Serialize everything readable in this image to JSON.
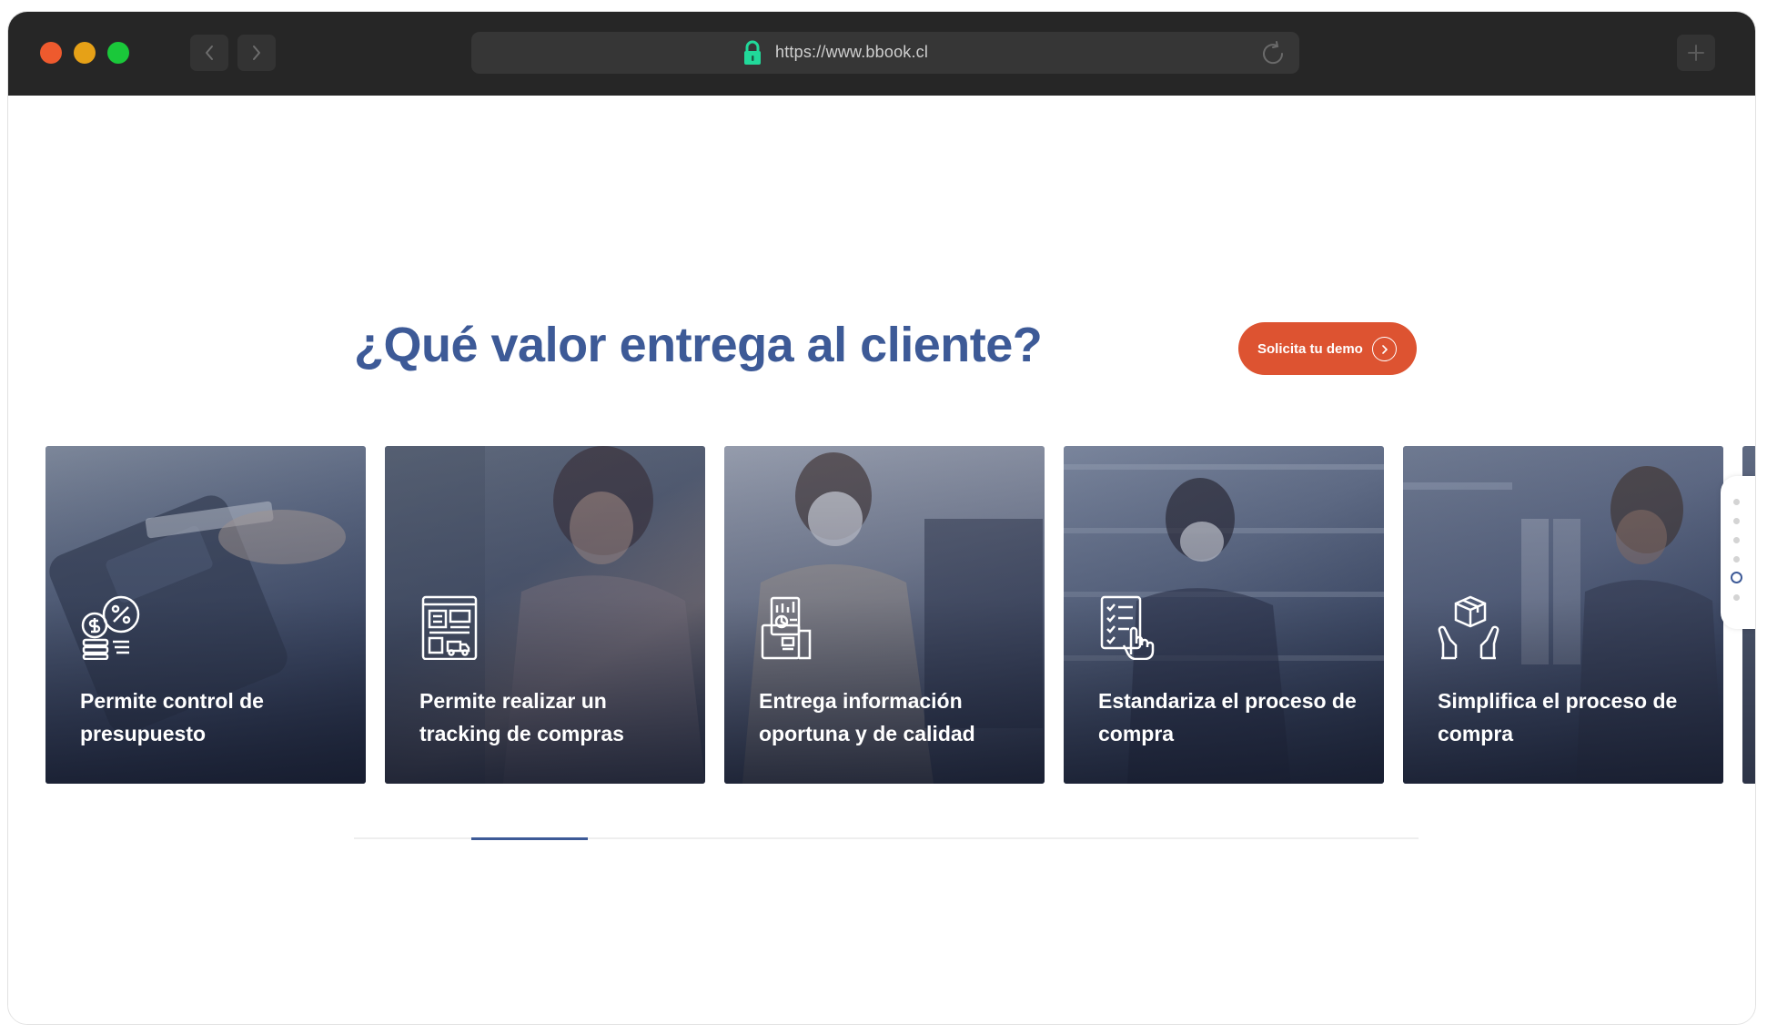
{
  "browser": {
    "url": "https://www.bbook.cl",
    "icons": {
      "back": "chevron-left-icon",
      "forward": "chevron-right-icon",
      "lock": "lock-icon",
      "reload": "reload-icon",
      "new_tab": "plus-icon"
    }
  },
  "section": {
    "title": "¿Qué valor entrega al cliente?",
    "cta_label": "Solicita tu demo",
    "cta_icon": "chevron-right-circle-icon",
    "accent_color": "#3d5a97",
    "cta_color": "#dd5331"
  },
  "cards": [
    {
      "label": "Permite control de presupuesto",
      "icon": "budget-coins-icon"
    },
    {
      "label": "Permite realizar un tracking de compras",
      "icon": "tracking-dashboard-icon"
    },
    {
      "label": "Entrega información oportuna y de calidad",
      "icon": "report-documents-icon"
    },
    {
      "label": "Estandariza el proceso de compra",
      "icon": "checklist-hand-icon"
    },
    {
      "label": "Simplifica el proceso de compra",
      "icon": "package-hands-icon"
    }
  ],
  "pagination": {
    "total": 6,
    "active_index": 4
  },
  "carousel_progress": {
    "start_fraction": 0.11,
    "end_fraction": 0.22
  }
}
